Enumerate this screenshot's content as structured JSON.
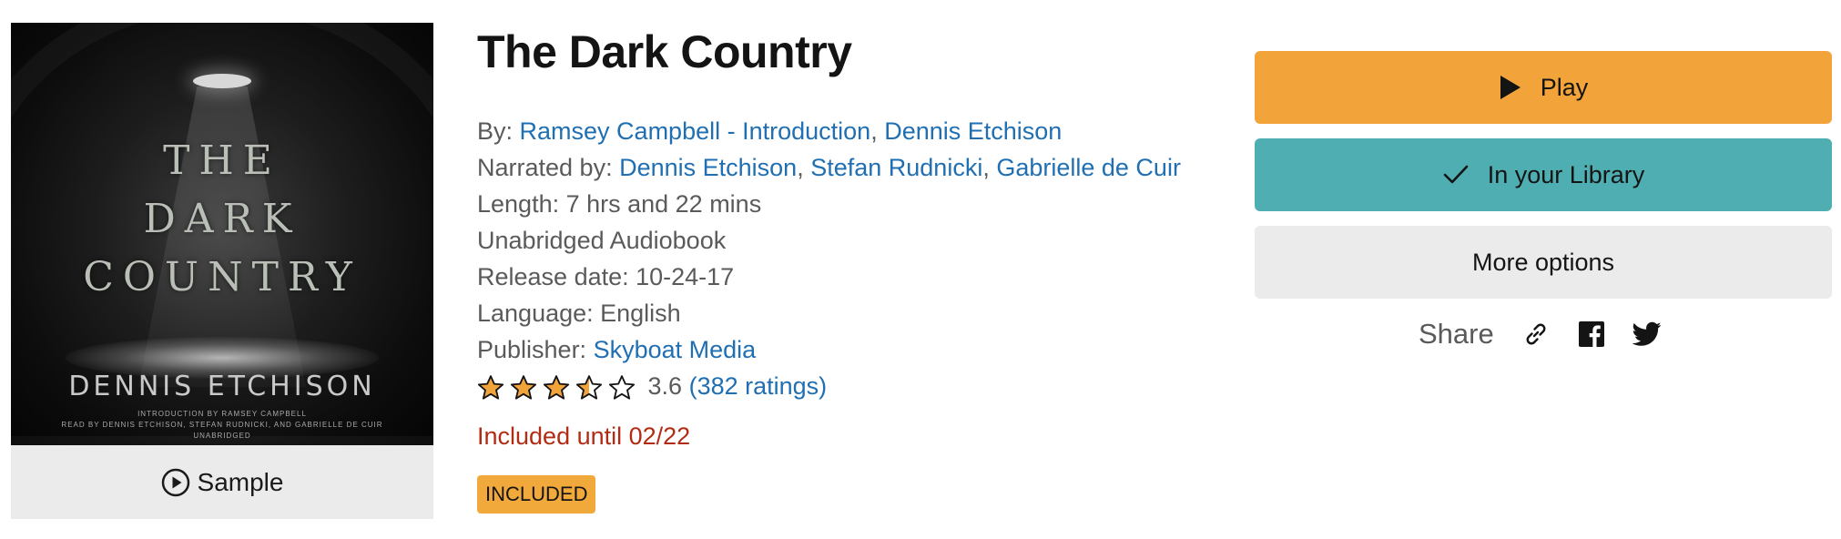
{
  "cover": {
    "title_lines": [
      "THE",
      "DARK",
      "COUNTRY"
    ],
    "author": "DENNIS ETCHISON",
    "intro_line": "INTRODUCTION BY RAMSEY CAMPBELL",
    "read_by_line": "READ BY DENNIS ETCHISON, STEFAN RUDNICKI, AND GABRIELLE DE CUIR",
    "edition": "UNABRIDGED"
  },
  "sample": {
    "label": "Sample",
    "icon": "play-circle-icon"
  },
  "book": {
    "title": "The Dark Country",
    "by_label": "By:",
    "authors": [
      "Ramsey Campbell - Introduction",
      "Dennis Etchison"
    ],
    "narrated_label": "Narrated by:",
    "narrators": [
      "Dennis Etchison",
      "Stefan Rudnicki",
      "Gabrielle de Cuir"
    ],
    "length": "Length: 7 hrs and 22 mins",
    "format": "Unabridged Audiobook",
    "release": "Release date: 10-24-17",
    "language": "Language: English",
    "publisher_label": "Publisher:",
    "publisher": "Skyboat Media",
    "rating_value": "3.6",
    "rating_count": "(382 ratings)",
    "stars": [
      1,
      1,
      1,
      0.5,
      0
    ],
    "included_until": "Included until 02/22",
    "badge": "INCLUDED"
  },
  "actions": {
    "play": "Play",
    "library": "In your Library",
    "more": "More options",
    "share": "Share"
  },
  "colors": {
    "play": "#f2a43a",
    "library": "#4faeb2",
    "link": "#1f6fb2",
    "included": "#b22b13",
    "star": "#f2a43a"
  }
}
